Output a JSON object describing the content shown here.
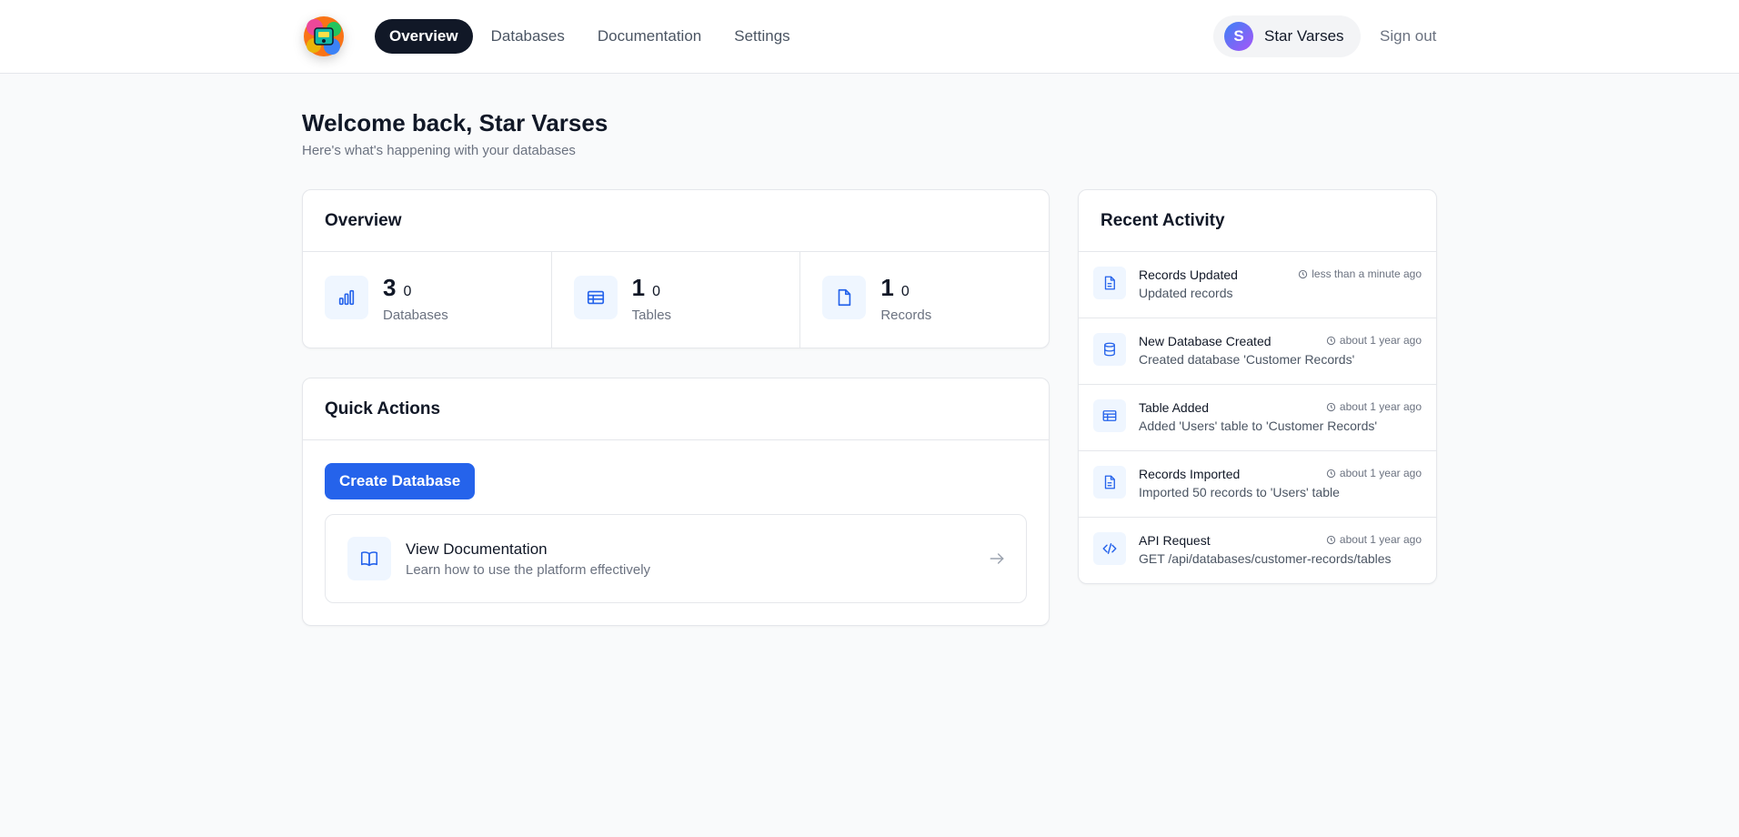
{
  "nav": {
    "items": [
      {
        "label": "Overview",
        "active": true
      },
      {
        "label": "Databases",
        "active": false
      },
      {
        "label": "Documentation",
        "active": false
      },
      {
        "label": "Settings",
        "active": false
      }
    ]
  },
  "user": {
    "initial": "S",
    "name": "Star Varses",
    "sign_out": "Sign out"
  },
  "welcome": {
    "title": "Welcome back, Star Varses",
    "subtitle": "Here's what's happening with your databases"
  },
  "overview": {
    "title": "Overview",
    "stats": [
      {
        "value": "3",
        "delta": "0",
        "label": "Databases",
        "icon": "bar-chart-icon"
      },
      {
        "value": "1",
        "delta": "0",
        "label": "Tables",
        "icon": "table-icon"
      },
      {
        "value": "1",
        "delta": "0",
        "label": "Records",
        "icon": "file-icon"
      }
    ]
  },
  "quick_actions": {
    "title": "Quick Actions",
    "create_button": "Create Database",
    "doc_title": "View Documentation",
    "doc_desc": "Learn how to use the platform effectively"
  },
  "activity": {
    "title": "Recent Activity",
    "items": [
      {
        "title": "Records Updated",
        "desc": "Updated records",
        "time": "less than a minute ago",
        "icon": "file-text-icon"
      },
      {
        "title": "New Database Created",
        "desc": "Created database 'Customer Records'",
        "time": "about 1 year ago",
        "icon": "database-icon"
      },
      {
        "title": "Table Added",
        "desc": "Added 'Users' table to 'Customer Records'",
        "time": "about 1 year ago",
        "icon": "table-icon"
      },
      {
        "title": "Records Imported",
        "desc": "Imported 50 records to 'Users' table",
        "time": "about 1 year ago",
        "icon": "file-text-icon"
      },
      {
        "title": "API Request",
        "desc": "GET /api/databases/customer-records/tables",
        "time": "about 1 year ago",
        "icon": "code-icon"
      }
    ]
  },
  "colors": {
    "accent": "#2563eb",
    "nav_active_bg": "#111827",
    "icon_bg": "#eff6ff"
  }
}
